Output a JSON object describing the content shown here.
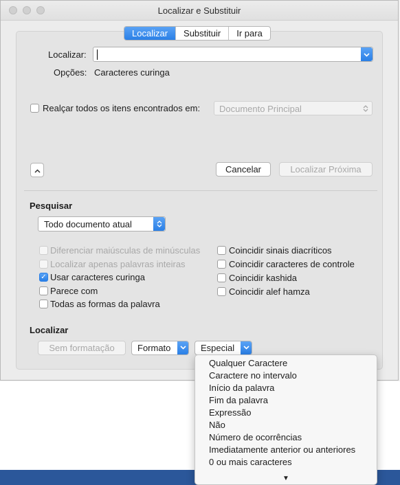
{
  "window": {
    "title": "Localizar e Substituir"
  },
  "tabs": [
    {
      "label": "Localizar",
      "active": true
    },
    {
      "label": "Substituir",
      "active": false
    },
    {
      "label": "Ir para",
      "active": false
    }
  ],
  "find": {
    "label": "Localizar:",
    "value": "",
    "options_label": "Opções:",
    "options_value": "Caracteres curinga",
    "highlight_label": "Realçar todos os itens encontrados em:",
    "highlight_checked": false,
    "highlight_scope": "Documento Principal",
    "cancel_label": "Cancelar",
    "find_next_label": "Localizar Próxima"
  },
  "search": {
    "heading": "Pesquisar",
    "scope_value": "Todo documento atual",
    "options_left": [
      {
        "label": "Diferenciar maiúsculas de minúsculas",
        "checked": false,
        "enabled": false
      },
      {
        "label": "Localizar apenas palavras inteiras",
        "checked": false,
        "enabled": false
      },
      {
        "label": "Usar caracteres curinga",
        "checked": true,
        "enabled": true
      },
      {
        "label": "Parece com",
        "checked": false,
        "enabled": true
      },
      {
        "label": "Todas as formas da palavra",
        "checked": false,
        "enabled": true
      }
    ],
    "options_right": [
      {
        "label": "Coincidir sinais diacríticos",
        "checked": false,
        "enabled": true
      },
      {
        "label": "Coincidir caracteres de controle",
        "checked": false,
        "enabled": true
      },
      {
        "label": "Coincidir kashida",
        "checked": false,
        "enabled": true
      },
      {
        "label": "Coincidir alef hamza",
        "checked": false,
        "enabled": true
      }
    ]
  },
  "locate": {
    "heading": "Localizar",
    "no_format_label": "Sem formatação",
    "format_label": "Formato",
    "special_label": "Especial"
  },
  "special_menu": {
    "items": [
      "Qualquer Caractere",
      "Caractere no intervalo",
      "Início da palavra",
      "Fim da palavra",
      "Expressão",
      "Não",
      "Número de ocorrências",
      "Imediatamente anterior ou anteriores",
      "0 ou mais caracteres"
    ],
    "more_glyph": "▼"
  },
  "colors": {
    "accent": "#2a7fe6",
    "doc_bar": "#2b579a"
  },
  "icons": {
    "caret": "chevron-down-icon",
    "stepper": "up-down-arrows-icon",
    "collapse": "chevron-up-icon",
    "check": "checkmark-icon"
  }
}
